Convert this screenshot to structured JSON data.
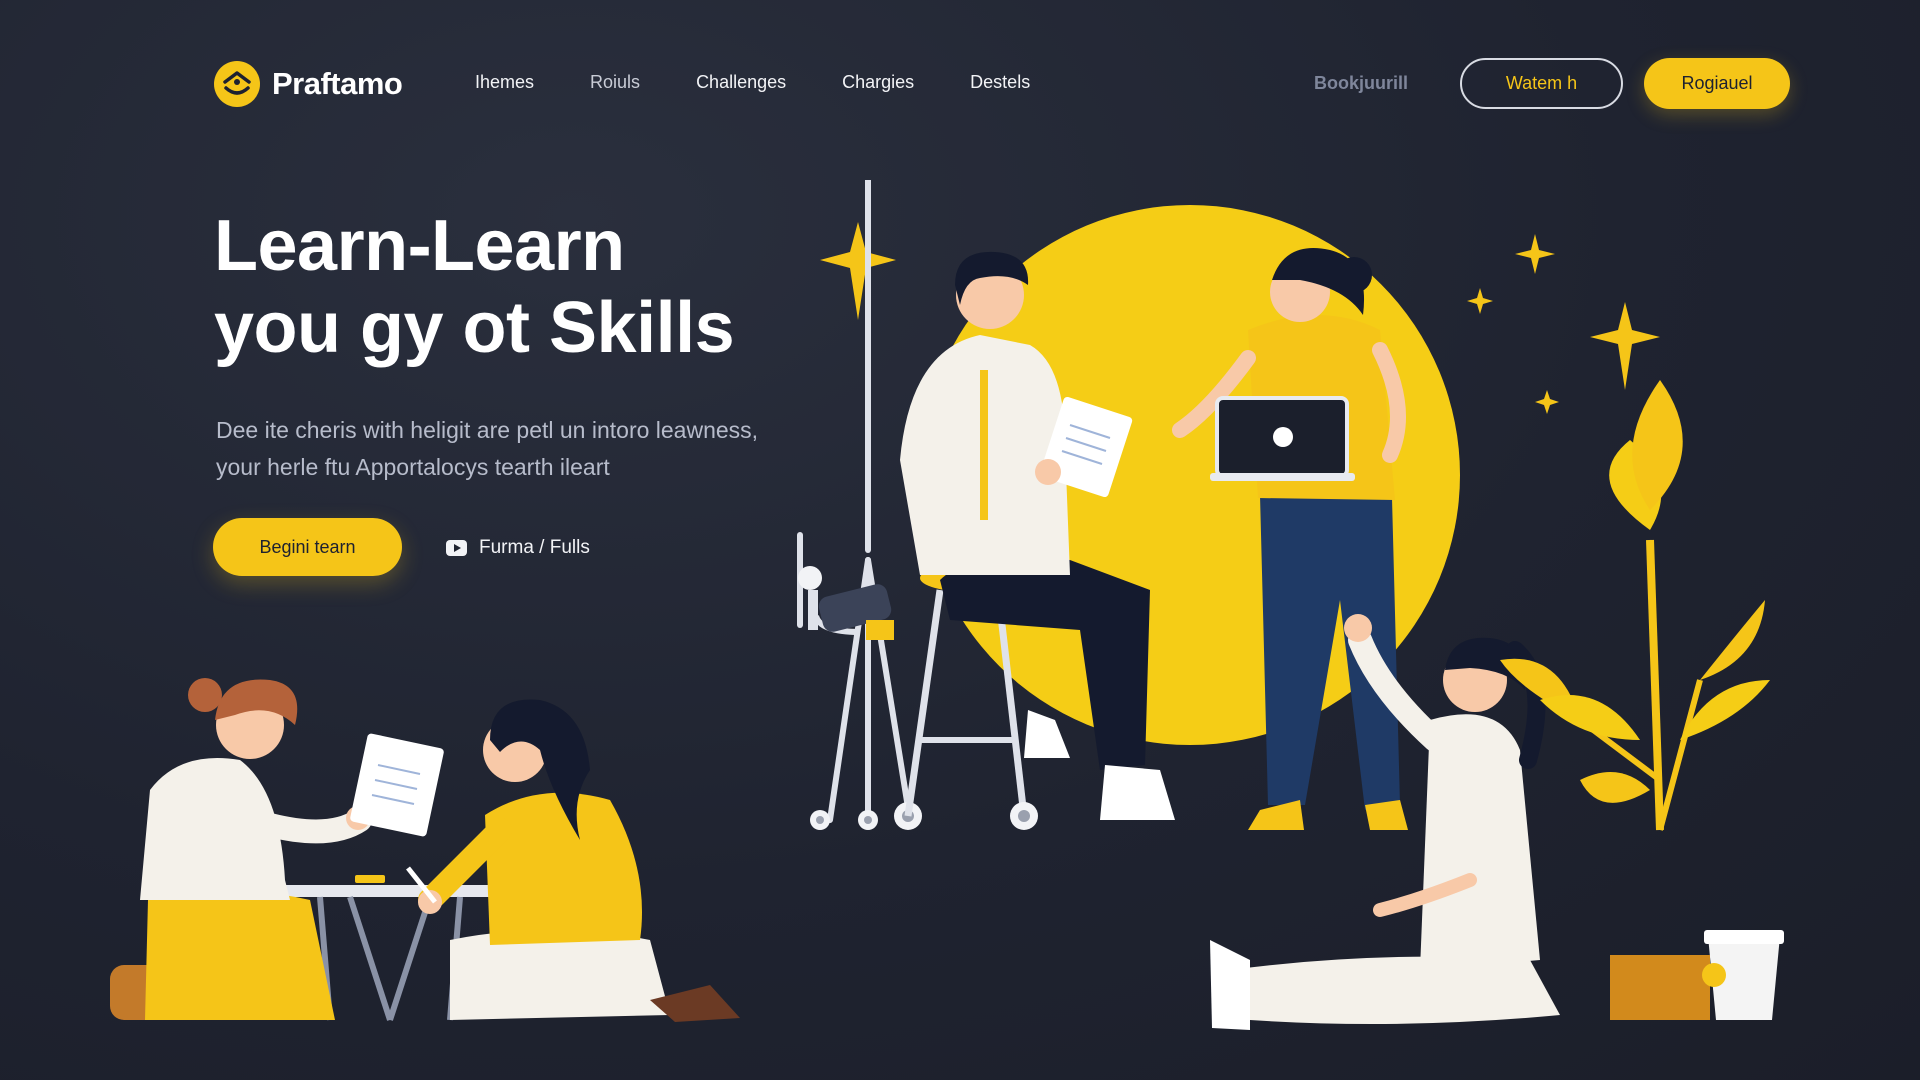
{
  "nav": {
    "brand": "Praftamo",
    "links": [
      "Ihemes",
      "Roiuls",
      "Challenges",
      "Chargies",
      "Destels"
    ],
    "secondary_link": "Bookjuurill",
    "outline_button": "Watem h",
    "solid_button": "Rogiauel"
  },
  "hero": {
    "title_line1": "Learn-Learn",
    "title_line2": "you gy ot Skills",
    "subtitle_line1": "Dee ite cheris with heligit are petl un intoro leawness,",
    "subtitle_line2": "your herle ftu Apportalocys tearth ileart",
    "primary_cta": "Begini tearn",
    "video_cta": "Furma / Fulls"
  },
  "colors": {
    "background": "#1f2330",
    "accent": "#f5c518",
    "text_primary": "#ffffff",
    "text_muted": "#b7bccb"
  },
  "icons": {
    "logo": "logo-mark-icon",
    "video": "play-icon"
  }
}
